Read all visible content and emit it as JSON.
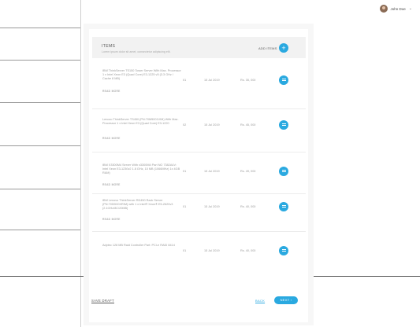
{
  "user": {
    "name": "John Doe",
    "avatar_icon": "user-avatar",
    "menu_icon": "chevron-down-icon"
  },
  "items": {
    "title": "ITEMS",
    "subtitle": "Lorem ipsum dolor sit amet, consectetur adipiscing elit.",
    "add_label": "ADD ITEMS",
    "add_icon": "+"
  },
  "rows": [
    {
      "description": "IBM ThinkServer TS150 Tower Server With Max. Processor 1 x Intel Xeon E3 (Quad Core) E3-1225 v5 (3.3 GHz / Cache 8 MB)",
      "read_more": "READ MORE",
      "qty": "01",
      "date": "15 Jul 2019",
      "price": "Rs. 35, 000"
    },
    {
      "description": "Lenovo ThinkServer TS450 (PN:70M5001VIM) With Max. Processor 1 x Intel Xeon E3 (Quad Core) E3-1220",
      "read_more": "READ MORE",
      "qty": "02",
      "date": "15 Jul 2019",
      "price": "Rs. 45, 000"
    },
    {
      "description": "IBM X3300M4 Server With x3300M4 Part NO 7382A4V: Intel Xeon E3-1230v2 1.8 GHz, 10 MB (1066MHz) 1x 4GB RAM)",
      "read_more": "READ MORE",
      "qty": "01",
      "date": "15 Jul 2019",
      "price": "Rs. 49, 000"
    },
    {
      "description": "IBM Lenovo ThinkServer RD450 Rack Server (PN:70DD00XRIM) with 1 x Intel® Xeon® E5-2620v3 (2.1GHz/8C/20MB)",
      "read_more": "READ MORE",
      "qty": "01",
      "date": "15 Jul 2019",
      "price": "Rs. 40, 000"
    },
    {
      "description": "Adptec 128 MB Raid Controller Part: PCI-e RAID 8414",
      "read_more": "",
      "qty": "01",
      "date": "15 Jul 2019",
      "price": "Rs. 40, 000"
    }
  ],
  "footer": {
    "save_draft": "SAVE DRAFT",
    "back": "BACK",
    "next": "NEXT"
  },
  "colors": {
    "accent": "#2aa9e0",
    "panel": "#f7f7f7",
    "header": "#f2f2f2"
  }
}
